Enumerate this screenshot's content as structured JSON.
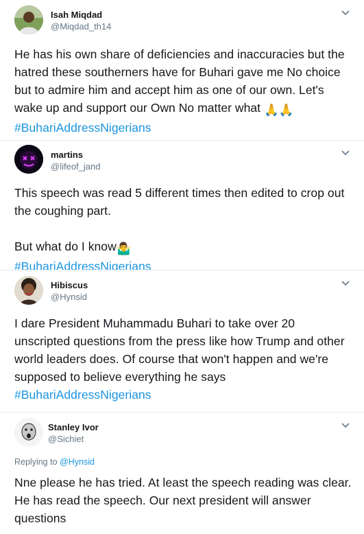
{
  "tweets": [
    {
      "name": "Isah Miqdad",
      "handle": "@Miqdad_th14",
      "text": "He has his own share of deficiencies and inaccuracies but the hatred these southerners have for Buhari gave me No choice but to admire him and accept him as one of our own. Let's wake up and support our Own No matter what",
      "emoji": "🙏🙏",
      "hashtag": "#BuhariAddressNigerians"
    },
    {
      "name": "martins",
      "handle": "@lifeof_jand",
      "text": "This speech was read 5 different times then edited to crop out the coughing part.",
      "text2": "But what do I know",
      "emoji": "🤷‍♂️",
      "hashtag": "#BuhariAddressNigerians"
    },
    {
      "name": "Hibiscus",
      "handle": "@Hynsid",
      "text": "I dare President Muhammadu Buhari to take over 20 unscripted questions from the press like how Trump and other world leaders does. Of course that won't happen and we're supposed to believe everything he says",
      "hashtag": "#BuhariAddressNigerians"
    },
    {
      "name": "Stanley Ivor",
      "handle": "@Sichiet",
      "reply_prefix": "Replying to",
      "reply_to": "@Hynsid",
      "text": "Nne please he has tried. At least the speech reading was clear. He has read the speech. Our next president will answer questions"
    }
  ],
  "colors": {
    "link": "#1b95e0",
    "secondary": "#657786",
    "separator": "#e6ecf0"
  },
  "icons": [
    "chevron-down-icon",
    "avatar"
  ]
}
